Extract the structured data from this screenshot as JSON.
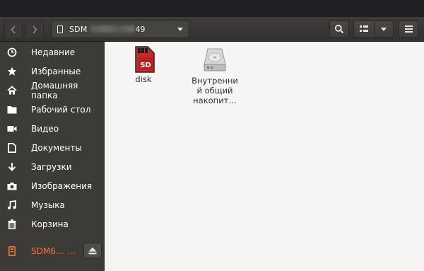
{
  "header": {
    "path_label": "SDM",
    "path_suffix": "49",
    "back_icon": "chevron-left-icon",
    "forward_icon": "chevron-right-icon",
    "search_icon": "search-icon",
    "view_icon": "view-list-icon",
    "menu_icon": "hamburger-menu-icon"
  },
  "sidebar": {
    "items": [
      {
        "label": "Недавние",
        "icon": "clock-icon"
      },
      {
        "label": "Избранные",
        "icon": "star-icon"
      },
      {
        "label": "Домашняя папка",
        "icon": "home-icon"
      },
      {
        "label": "Рабочий стол",
        "icon": "folder-icon"
      },
      {
        "label": "Видео",
        "icon": "video-icon"
      },
      {
        "label": "Документы",
        "icon": "document-icon"
      },
      {
        "label": "Загрузки",
        "icon": "download-icon"
      },
      {
        "label": "Изображения",
        "icon": "camera-icon"
      },
      {
        "label": "Музыка",
        "icon": "music-icon"
      },
      {
        "label": "Корзина",
        "icon": "trash-icon"
      }
    ],
    "device": {
      "label": "SDM6… …",
      "icon": "device-icon",
      "eject_icon": "eject-icon"
    }
  },
  "files": [
    {
      "name": "disk",
      "icon": "sd-card-icon"
    },
    {
      "name_lines": [
        "Внутренни",
        "й общий",
        "накопит…"
      ],
      "icon": "hard-drive-icon"
    }
  ],
  "colors": {
    "accent": "#f37437",
    "sidebar_bg": "#3c3b37",
    "content_bg": "#f6f5f4",
    "sd_red": "#c7292a"
  }
}
